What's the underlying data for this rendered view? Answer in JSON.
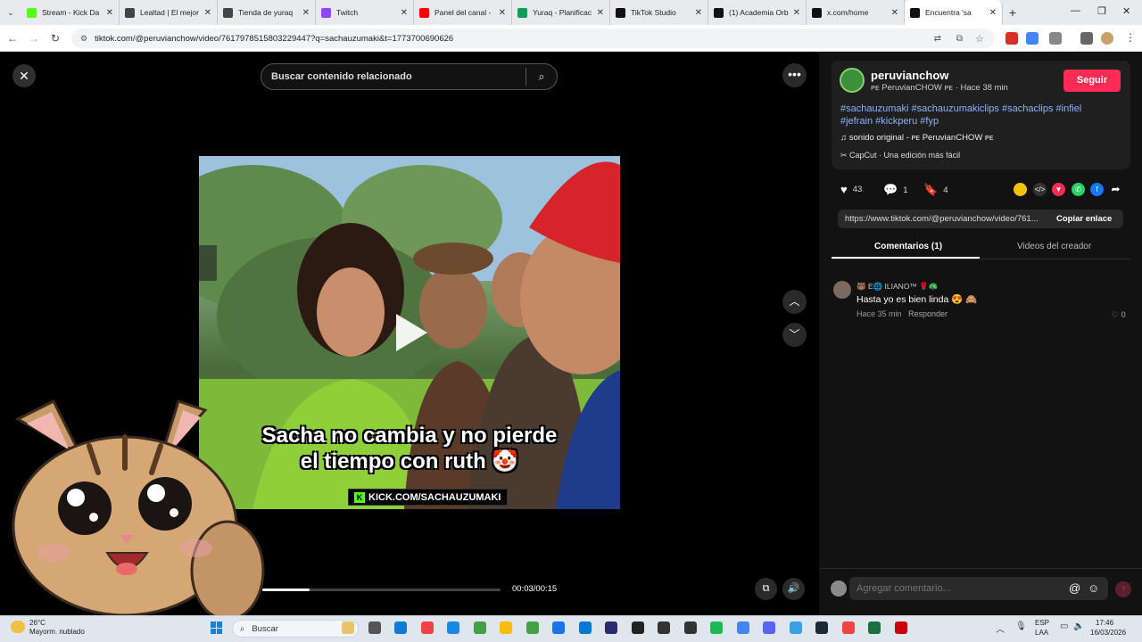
{
  "browser": {
    "tabs": [
      {
        "title": "Stream - Kick Da",
        "color": "#53fc18"
      },
      {
        "title": "Lealtad | El mejor",
        "color": "#444444"
      },
      {
        "title": "Tienda de yuraq",
        "color": "#444444"
      },
      {
        "title": "Twitch",
        "color": "#9146ff"
      },
      {
        "title": "Panel del canal -",
        "color": "#ff0000"
      },
      {
        "title": "Yuraq - Planificac",
        "color": "#0f9d58"
      },
      {
        "title": "TikTok Studio",
        "color": "#111111"
      },
      {
        "title": "(1) Academia Orb",
        "color": "#111111"
      },
      {
        "title": "x.com/home",
        "color": "#111111"
      },
      {
        "title": "Encuentra 'sa",
        "color": "#111111",
        "active": true
      }
    ],
    "url": "tiktok.com/@peruvianchow/video/7617978515803229447?q=sachauzumaki&t=1773700690626"
  },
  "video": {
    "search_placeholder": "Buscar contenido relacionado",
    "caption_line1": "Sacha no cambia y no pierde",
    "caption_line2": "el tiempo con ruth 🤡",
    "watermark": "KICK.COM/SACHAUZUMAKI",
    "time": "00:03/00:15",
    "progress": 0.2
  },
  "post": {
    "username": "peruvianchow",
    "display_meta": "ᴘᴇ PeruvianCHOW ᴘᴇ · Hace 38 min",
    "follow_label": "Seguir",
    "hashtags": "#sachauzumaki #sachauzumakiclips #sachaclips #infiel #jefrain #kickperu #fyp",
    "sound": "sonido original - ᴘᴇ PeruvianCHOW ᴘᴇ",
    "capcut": "CapCut · Una edición más fácil",
    "likes": "43",
    "comments": "1",
    "saves": "4",
    "link": "https://www.tiktok.com/@peruvianchow/video/761...",
    "copy_label": "Copiar enlace"
  },
  "tabs": {
    "comments": "Comentarios (1)",
    "creator": "Videos del creador"
  },
  "comment": {
    "user": "🐻 E🌐 ILIANO™ 🌹🦚",
    "text": "Hasta yo es bien linda 😍 🙈",
    "time": "Hace 35 min",
    "reply": "Responder",
    "likes": "0"
  },
  "composer": {
    "placeholder": "Agregar comentario..."
  },
  "taskbar": {
    "weather_temp": "26°C",
    "weather_desc": "Mayorm. nublado",
    "search": "Buscar",
    "lang1": "ESP",
    "lang2": "LAA",
    "time": "17:46",
    "date": "16/03/2026"
  }
}
